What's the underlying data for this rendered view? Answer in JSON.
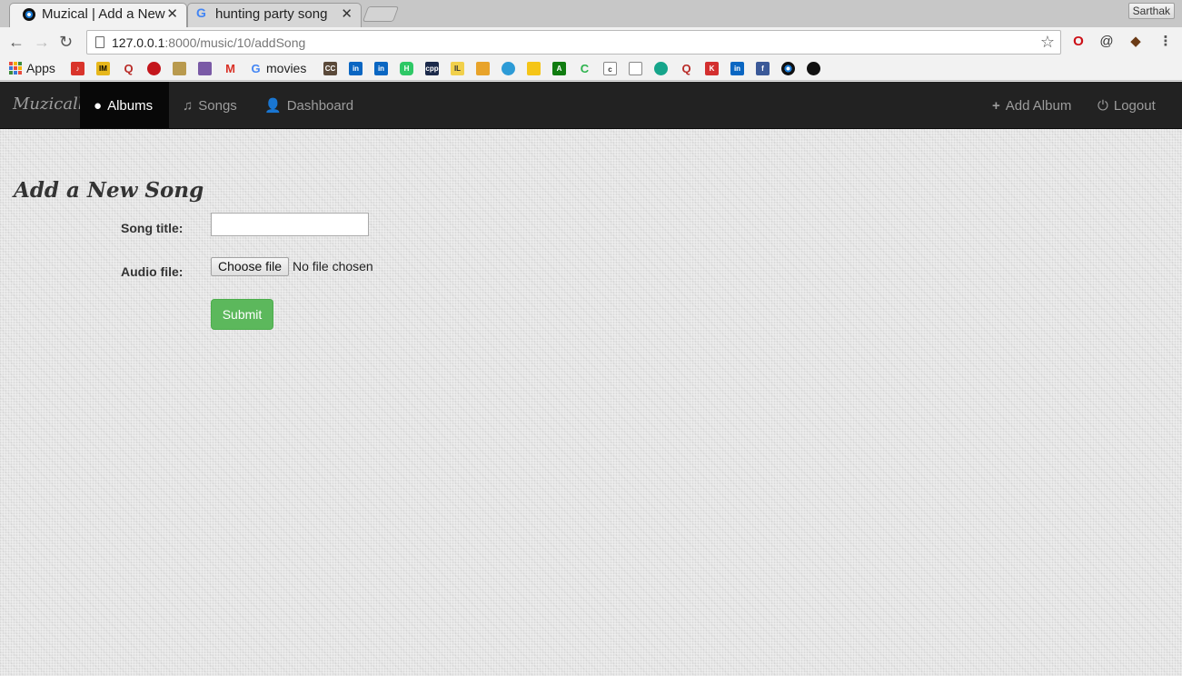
{
  "browser": {
    "tabs": [
      {
        "title": "Muzical | Add a New",
        "active": true,
        "favicon": "muzical-disc-icon"
      },
      {
        "title": "hunting party song",
        "active": false,
        "favicon": "google-g-icon"
      }
    ],
    "close_glyph": "✕",
    "profile_name": "Sarthak",
    "url_host": "127.0.0.1",
    "url_rest": ":8000/music/10/addSong",
    "bookmarks": [
      {
        "label": "Apps",
        "icon": "apps-grid-icon"
      },
      {
        "label": "movies",
        "icon": "google-g-icon"
      }
    ]
  },
  "navbar": {
    "brand": "Muzicall",
    "items": [
      {
        "label": "Albums",
        "icon": "globe-icon",
        "active": true
      },
      {
        "label": "Songs",
        "icon": "music-note-icon",
        "active": false
      },
      {
        "label": "Dashboard",
        "icon": "user-icon",
        "active": false
      }
    ],
    "right_items": [
      {
        "label": "Add Album",
        "icon": "plus-icon"
      },
      {
        "label": "Logout",
        "icon": "power-icon"
      }
    ]
  },
  "form": {
    "heading": "Add a New Song",
    "song_title_label": "Song title:",
    "song_title_value": "",
    "audio_file_label": "Audio file:",
    "file_button_label": "Choose file",
    "file_status": "No file chosen",
    "submit_label": "Submit"
  },
  "colors": {
    "navbar_bg": "#222222",
    "submit_bg": "#5cb85c"
  }
}
